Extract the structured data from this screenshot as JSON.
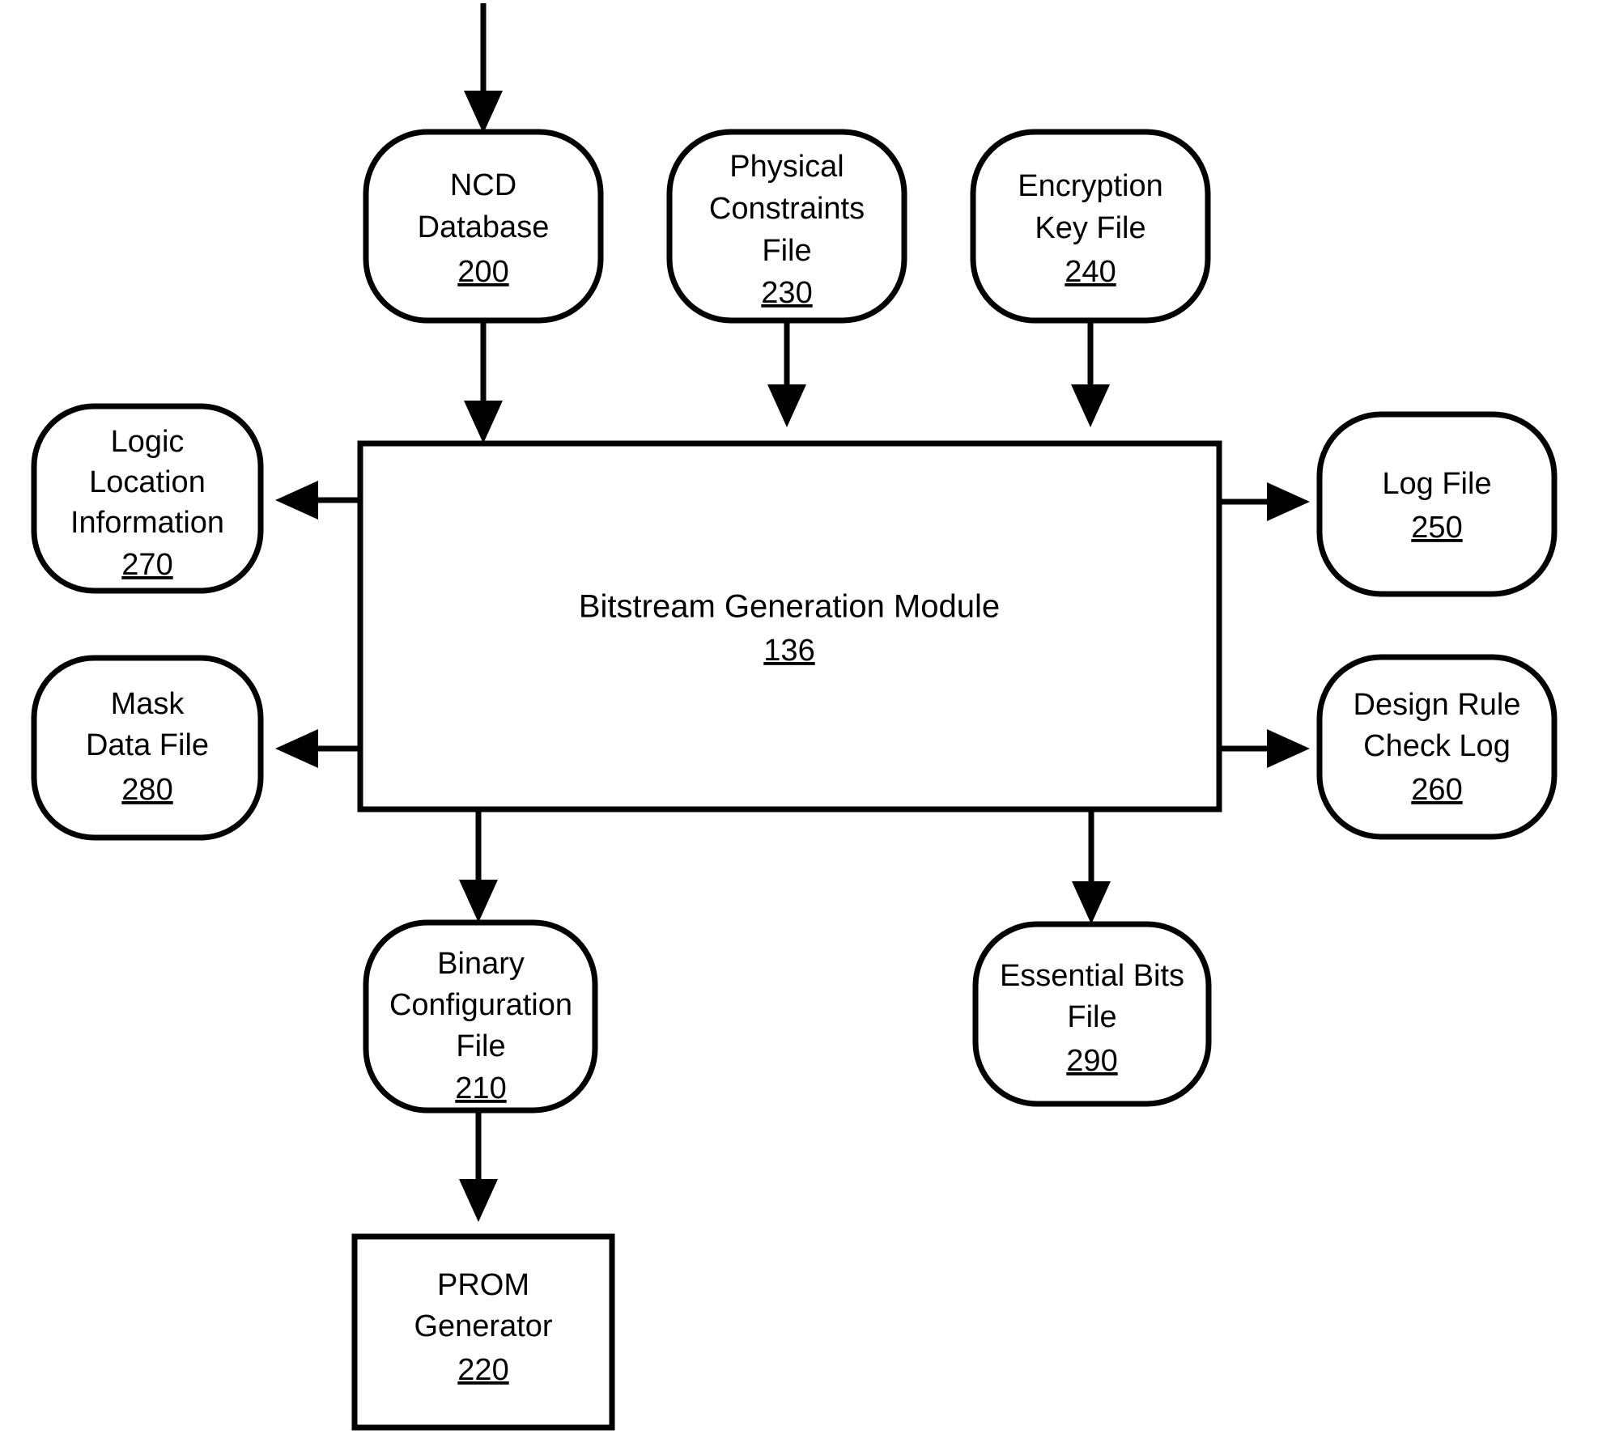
{
  "figure": {
    "type": "patent-block-diagram",
    "background_color": "#ffffff",
    "line_color": "#000000"
  },
  "nodes": {
    "ncd_database": {
      "lines": [
        "NCD",
        "Database"
      ],
      "ref": "200",
      "shape": "rounded"
    },
    "physical_constraints_file": {
      "lines": [
        "Physical",
        "Constraints",
        "File"
      ],
      "ref": "230",
      "shape": "rounded"
    },
    "encryption_key_file": {
      "lines": [
        "Encryption",
        "Key File"
      ],
      "ref": "240",
      "shape": "rounded"
    },
    "logic_location_information": {
      "lines": [
        "Logic",
        "Location",
        "Information"
      ],
      "ref": "270",
      "shape": "rounded"
    },
    "mask_data_file": {
      "lines": [
        "Mask",
        "Data File"
      ],
      "ref": "280",
      "shape": "rounded"
    },
    "bitstream_generation_module": {
      "lines": [
        "Bitstream Generation Module"
      ],
      "ref": "136",
      "shape": "rectangle"
    },
    "log_file": {
      "lines": [
        "Log File"
      ],
      "ref": "250",
      "shape": "rounded"
    },
    "design_rule_check_log": {
      "lines": [
        "Design Rule",
        "Check Log"
      ],
      "ref": "260",
      "shape": "rounded"
    },
    "binary_configuration_file": {
      "lines": [
        "Binary",
        "Configuration",
        "File"
      ],
      "ref": "210",
      "shape": "rounded"
    },
    "essential_bits_file": {
      "lines": [
        "Essential Bits",
        "File"
      ],
      "ref": "290",
      "shape": "rounded"
    },
    "prom_generator": {
      "lines": [
        "PROM",
        "Generator"
      ],
      "ref": "220",
      "shape": "rectangle"
    }
  },
  "connections": [
    {
      "from": "external-input",
      "to": "ncd_database",
      "direction": "down"
    },
    {
      "from": "ncd_database",
      "to": "bitstream_generation_module",
      "direction": "down"
    },
    {
      "from": "physical_constraints_file",
      "to": "bitstream_generation_module",
      "direction": "down"
    },
    {
      "from": "encryption_key_file",
      "to": "bitstream_generation_module",
      "direction": "down"
    },
    {
      "from": "bitstream_generation_module",
      "to": "logic_location_information",
      "direction": "left"
    },
    {
      "from": "bitstream_generation_module",
      "to": "mask_data_file",
      "direction": "left"
    },
    {
      "from": "bitstream_generation_module",
      "to": "log_file",
      "direction": "right"
    },
    {
      "from": "bitstream_generation_module",
      "to": "design_rule_check_log",
      "direction": "right"
    },
    {
      "from": "bitstream_generation_module",
      "to": "binary_configuration_file",
      "direction": "down"
    },
    {
      "from": "bitstream_generation_module",
      "to": "essential_bits_file",
      "direction": "down"
    },
    {
      "from": "binary_configuration_file",
      "to": "prom_generator",
      "direction": "down"
    }
  ]
}
